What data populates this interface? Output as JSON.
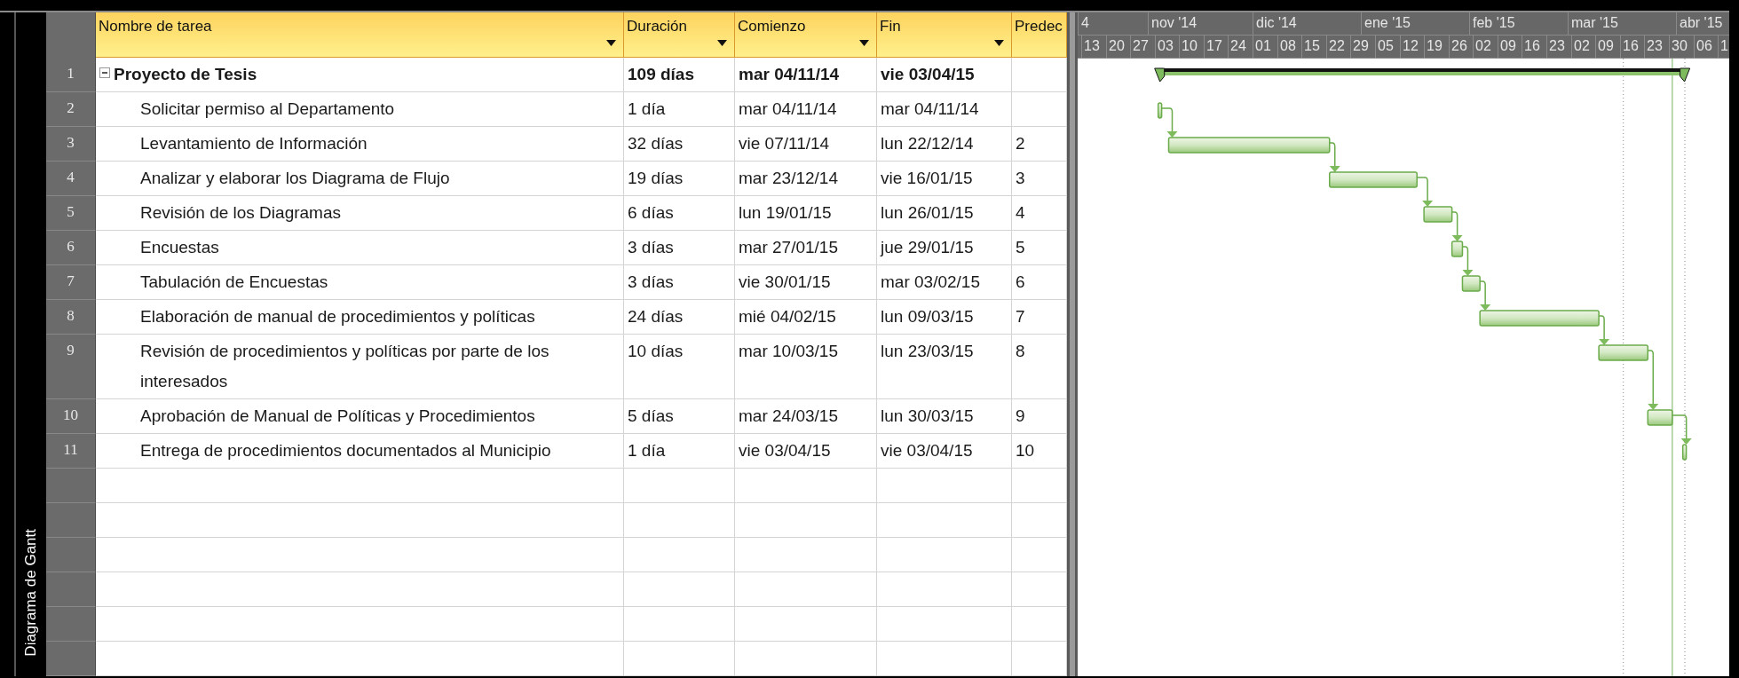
{
  "side_label": "Diagrama de Gantt",
  "columns": [
    {
      "label": "Nombre de tarea",
      "has_menu": true
    },
    {
      "label": "Duración",
      "has_menu": true
    },
    {
      "label": "Comienzo",
      "has_menu": true
    },
    {
      "label": "Fin",
      "has_menu": true
    },
    {
      "label": "Predec",
      "has_menu": false
    }
  ],
  "timescale": {
    "months": [
      "4",
      "nov '14",
      "dic '14",
      "ene '15",
      "feb '15",
      "mar '15",
      "abr '15"
    ],
    "weeks": [
      "13",
      "20",
      "27",
      "03",
      "10",
      "17",
      "24",
      "01",
      "08",
      "15",
      "22",
      "29",
      "05",
      "12",
      "19",
      "26",
      "02",
      "09",
      "16",
      "23",
      "02",
      "09",
      "16",
      "23",
      "30",
      "06",
      "1"
    ]
  },
  "tasks": [
    {
      "id": "1",
      "kind": "summary",
      "name": "Proyecto de Tesis",
      "duration": "109 días",
      "start": "mar 04/11/14",
      "finish": "vie 03/04/15",
      "expanded": true,
      "children": [
        {
          "id": "2",
          "kind": "task",
          "name": "Solicitar permiso al Departamento",
          "duration": "1 día",
          "start": "mar 04/11/14",
          "finish": "mar 04/11/14"
        },
        {
          "id": "3",
          "kind": "task",
          "name": "Levantamiento de Información",
          "duration": "32 días",
          "start": "vie 07/11/14",
          "finish": "lun 22/12/14",
          "predecessors": "2"
        },
        {
          "id": "4",
          "kind": "task",
          "name": "Analizar y elaborar los Diagrama de Flujo",
          "duration": "19 días",
          "start": "mar 23/12/14",
          "finish": "vie 16/01/15",
          "predecessors": "3"
        },
        {
          "id": "5",
          "kind": "task",
          "name": "Revisión de los Diagramas",
          "duration": "6 días",
          "start": "lun 19/01/15",
          "finish": "lun 26/01/15",
          "predecessors": "4"
        },
        {
          "id": "6",
          "kind": "task",
          "name": "Encuestas",
          "duration": "3 días",
          "start": "mar 27/01/15",
          "finish": "jue 29/01/15",
          "predecessors": "5"
        },
        {
          "id": "7",
          "kind": "task",
          "name": "Tabulación de Encuestas",
          "duration": "3 días",
          "start": "vie 30/01/15",
          "finish": "mar 03/02/15",
          "predecessors": "6"
        },
        {
          "id": "8",
          "kind": "task",
          "name": "Elaboración de manual de procedimientos y políticas",
          "duration": "24 días",
          "start": "mié 04/02/15",
          "finish": "lun 09/03/15",
          "predecessors": "7"
        },
        {
          "id": "9",
          "kind": "task",
          "name": "Revisión de procedimientos y políticas por parte de los interesados",
          "duration": "10 días",
          "start": "mar 10/03/15",
          "finish": "lun 23/03/15",
          "predecessors": "8"
        },
        {
          "id": "10",
          "kind": "task",
          "name": "Aprobación de Manual de Políticas y Procedimientos",
          "duration": "5 días",
          "start": "mar 24/03/15",
          "finish": "lun 30/03/15",
          "predecessors": "9"
        },
        {
          "id": "11",
          "kind": "task",
          "name": "Entrega de procedimientos documentados al Municipio",
          "duration": "1 día",
          "start": "vie 03/04/15",
          "finish": "vie 03/04/15",
          "predecessors": "10"
        }
      ]
    }
  ]
}
